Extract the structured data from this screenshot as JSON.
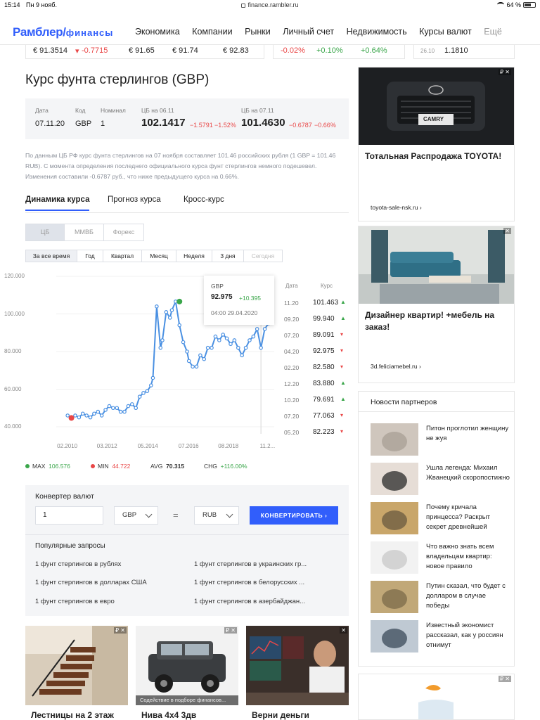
{
  "status_bar": {
    "time": "15:14",
    "date": "Пн 9 нояб.",
    "url": "finance.rambler.ru",
    "battery": "64 %",
    "battery_level": 0.64
  },
  "header": {
    "logo_main": "Рамблер/",
    "logo_sub": "финансы",
    "nav": [
      "Экономика",
      "Компании",
      "Рынки",
      "Личный счет",
      "Недвижимость",
      "Курсы валют",
      "Ещё"
    ]
  },
  "ticker": {
    "left": [
      "€ 91.3514",
      "-0.7715",
      "€ 91.65",
      "€ 91.74",
      "€ 92.83"
    ],
    "middle": [
      "-0.02%",
      "+0.10%",
      "+0.64%"
    ],
    "right": [
      "26.10",
      "1.1810"
    ]
  },
  "page_title": "Курс фунта стерлингов (GBP)",
  "info": {
    "labels": [
      "Дата",
      "Код",
      "Номинал",
      "ЦБ на 06.11",
      "ЦБ на 07.11"
    ],
    "date": "07.11.20",
    "code": "GBP",
    "nominal": "1",
    "cb1_value": "102.1417",
    "cb1_change": "−1.5791",
    "cb1_pct": "−1.52%",
    "cb2_value": "101.4630",
    "cb2_change": "−0.6787",
    "cb2_pct": "−0.66%"
  },
  "description": "По данным ЦБ РФ курс фунта стерлингов на 07 ноября составляет 101.46 российских рубля (1 GBP = 101.46 RUB). С момента определения последнего официального курса фунт стерлингов немного подешевел. Изменения составили -0.6787 руб., что ниже предыдущего курса на 0.66%.",
  "tabs": [
    "Динамика курса",
    "Прогноз курса",
    "Кросс-курс"
  ],
  "sources": [
    "ЦБ",
    "ММВБ",
    "Форекс"
  ],
  "ranges": [
    "За все время",
    "Год",
    "Квартал",
    "Месяц",
    "Неделя",
    "3 дня",
    "Сегодня"
  ],
  "tooltip": {
    "label": "GBP",
    "value": "92.975",
    "change": "+10.395",
    "datetime": "04:00  29.04.2020"
  },
  "history": {
    "headers": [
      "Дата",
      "Курс"
    ],
    "rows": [
      {
        "date": "11.20",
        "value": "101.463",
        "dir": "up"
      },
      {
        "date": "09.20",
        "value": "99.940",
        "dir": "up"
      },
      {
        "date": "07.20",
        "value": "89.091",
        "dir": "down"
      },
      {
        "date": "04.20",
        "value": "92.975",
        "dir": "down"
      },
      {
        "date": "02.20",
        "value": "82.580",
        "dir": "down"
      },
      {
        "date": "12.20",
        "value": "83.880",
        "dir": "up"
      },
      {
        "date": "10.20",
        "value": "79.691",
        "dir": "up"
      },
      {
        "date": "07.20",
        "value": "77.063",
        "dir": "down"
      },
      {
        "date": "05.20",
        "value": "82.223",
        "dir": "down"
      }
    ]
  },
  "stats": {
    "max_label": "MAX",
    "max_value": "106.576",
    "min_label": "MIN",
    "min_value": "44.722",
    "avg_label": "AVG",
    "avg_value": "70.315",
    "chg_label": "CHG",
    "chg_value": "+116.00%"
  },
  "chart_data": {
    "type": "line",
    "title": "",
    "xlabel": "",
    "ylabel": "",
    "ylim": [
      40,
      120
    ],
    "y_ticks": [
      "120.000",
      "100.000",
      "80.000",
      "60.000",
      "40.000"
    ],
    "x_ticks": [
      "02.2010",
      "03.2012",
      "05.2014",
      "07.2016",
      "08.2018",
      "11.2..."
    ],
    "x_tick_positions": [
      2010.1,
      2012.2,
      2014.35,
      2016.5,
      2018.6,
      2020.8
    ],
    "x_range": [
      2009.5,
      2021.0
    ],
    "series": [
      {
        "x": [
          2010.1,
          2010.3,
          2010.5,
          2010.7,
          2010.9,
          2011.1,
          2011.3,
          2011.5,
          2011.7,
          2011.9,
          2012.1,
          2012.3,
          2012.5,
          2012.7,
          2012.9,
          2013.1,
          2013.3,
          2013.5,
          2013.7,
          2013.9,
          2014.1,
          2014.3,
          2014.5,
          2014.6,
          2014.8,
          2015.0,
          2015.1,
          2015.3,
          2015.5,
          2015.6,
          2015.8,
          2016.0,
          2016.2,
          2016.4,
          2016.5,
          2016.7,
          2016.9,
          2017.1,
          2017.3,
          2017.5,
          2017.7,
          2017.9,
          2018.1,
          2018.3,
          2018.5,
          2018.7,
          2018.9,
          2019.1,
          2019.3,
          2019.5,
          2019.7,
          2019.9,
          2020.1,
          2020.3,
          2020.5,
          2020.7,
          2020.85
        ],
        "y": [
          46,
          44.7,
          46,
          45,
          47,
          46,
          45,
          47,
          48,
          46,
          49,
          51,
          50,
          50,
          48,
          48,
          51,
          52,
          50,
          56,
          58,
          59,
          62,
          66,
          104,
          82,
          86,
          101,
          98,
          102,
          106.6,
          94,
          85,
          80,
          75,
          72,
          72,
          78,
          76,
          82,
          82,
          88,
          86,
          89,
          87,
          84,
          86,
          82,
          78,
          82,
          86,
          88,
          92,
          82,
          92,
          95,
          99
        ]
      }
    ],
    "markers": [
      {
        "label": "MAX",
        "x": 2016.0,
        "y": 106.6,
        "color": "#3aa64a"
      },
      {
        "label": "MIN",
        "x": 2010.3,
        "y": 44.7,
        "color": "#e94747"
      }
    ],
    "line_color": "#4a90e2"
  },
  "converter": {
    "title": "Конвертер валют",
    "amount": "1",
    "from": "GBP",
    "eq": "=",
    "to": "RUB",
    "button": "КОНВЕРТИРОВАТЬ  ›",
    "popular_title": "Популярные запросы",
    "popular": [
      "1 фунт стерлингов в рублях",
      "1 фунт стерлингов в долларах США",
      "1 фунт стерлингов в евро",
      "1 фунт стерлингов в украинских гр...",
      "1 фунт стерлингов в белорусских ...",
      "1 фунт стерлингов в азербайджан..."
    ]
  },
  "bottom_ads": [
    {
      "caption": "Лестницы на 2 этаж",
      "badge": "₽ ✕"
    },
    {
      "caption": "Нива 4х4 3дв",
      "badge": "₽ ✕",
      "overlay": "Содействие в подборе финансов..."
    },
    {
      "caption": "Верни деньги",
      "badge": "✕"
    }
  ],
  "right_ads": [
    {
      "caption": "Тотальная Распродажа TOYOTA!",
      "source": "toyota-sale-nsk.ru  ›",
      "badge": "₽ ✕",
      "plate": "CAMRY"
    },
    {
      "caption": "Дизайнер квартир! +мебель на заказ!",
      "source": "3d.feliciamebel.ru  ›",
      "badge": "✕"
    }
  ],
  "partners": {
    "title": "Новости партнеров",
    "items": [
      "Питон проглотил женщину не жуя",
      "Ушла легенда: Михаил Жванецкий скоропостижно",
      "Почему кричала принцесса? Раскрыт секрет древнейшей",
      "Что важно знать всем владельцам квартир: новое правило",
      "Путин сказал, что будет с долларом в случае победы",
      "Известный экономист рассказал, как у россиян отнимут"
    ]
  },
  "bottom_right_ad_badge": "₽ ✕",
  "colors": {
    "brand": "#315efb",
    "red": "#e94747",
    "green": "#3aa64a",
    "panel_bg": "#f4f5f7"
  }
}
